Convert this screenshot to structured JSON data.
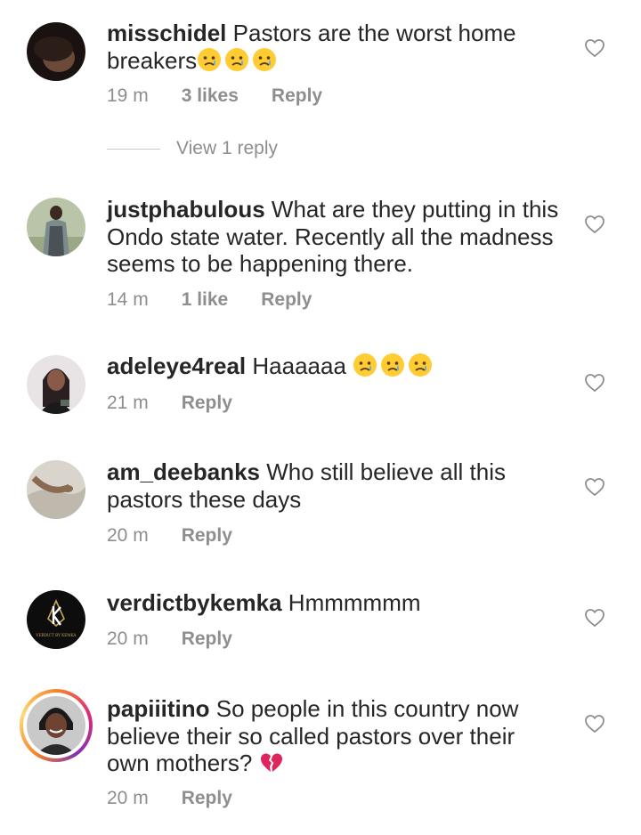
{
  "comments": [
    {
      "username": "misschidel",
      "text": "Pastors are the worst home breakers",
      "emojis": [
        "crying-face",
        "crying-face",
        "crying-face"
      ],
      "time": "19 m",
      "likes": "3 likes",
      "reply": "Reply",
      "view_replies": "View 1 reply"
    },
    {
      "username": "justphabulous",
      "text": "What are they putting in this Ondo state water. Recently all the madness seems to be happening there.",
      "time": "14 m",
      "likes": "1 like",
      "reply": "Reply"
    },
    {
      "username": "adeleye4real",
      "text": "Haaaaaa",
      "emojis": [
        "crying-face",
        "crying-face",
        "crying-face"
      ],
      "time": "21 m",
      "reply": "Reply"
    },
    {
      "username": "am_deebanks",
      "text": "Who still believe all this pastors these days",
      "time": "20 m",
      "reply": "Reply"
    },
    {
      "username": "verdictbykemka",
      "text": "Hmmmmmm",
      "time": "20 m",
      "reply": "Reply",
      "avatar_logo_text": "VERDICT BY KEMKA"
    },
    {
      "username": "papiiitino",
      "text": "So people in this country now believe their so called pastors over their own mothers?",
      "emojis": [
        "broken-heart"
      ],
      "time": "20 m",
      "reply": "Reply"
    }
  ],
  "colors": {
    "text": "#262626",
    "meta": "#8e8e8e",
    "heart_outline": "#8e8e8e",
    "broken_heart": "#e0245e",
    "emoji_face": "#ffcc33",
    "tear": "#5dadec"
  }
}
